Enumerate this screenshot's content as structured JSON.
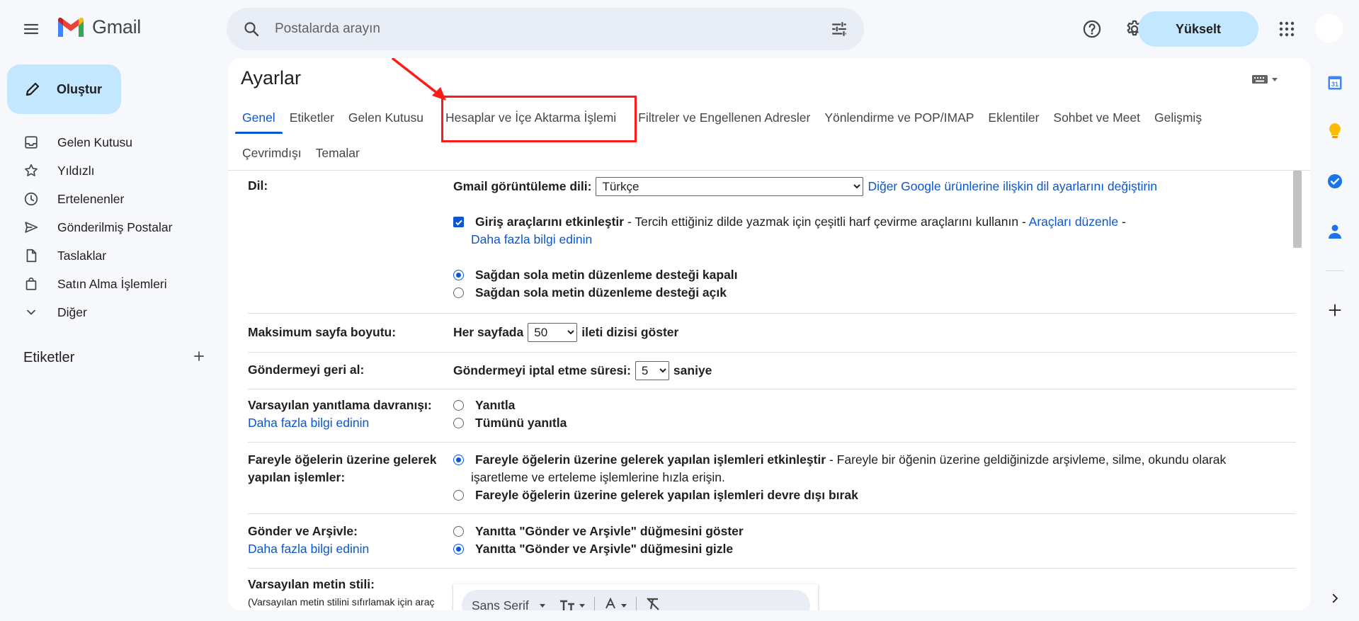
{
  "app": {
    "name": "Gmail"
  },
  "search": {
    "placeholder": "Postalarda arayın"
  },
  "header": {
    "upgrade_label": "Yükselt"
  },
  "compose": {
    "label": "Oluştur"
  },
  "nav": {
    "items": [
      {
        "label": "Gelen Kutusu",
        "icon": "inbox-icon"
      },
      {
        "label": "Yıldızlı",
        "icon": "star-icon"
      },
      {
        "label": "Ertelenenler",
        "icon": "clock-icon"
      },
      {
        "label": "Gönderilmiş Postalar",
        "icon": "send-icon"
      },
      {
        "label": "Taslaklar",
        "icon": "draft-icon"
      },
      {
        "label": "Satın Alma İşlemleri",
        "icon": "shopping-bag-icon"
      },
      {
        "label": "Diğer",
        "icon": "chevron-down-icon"
      }
    ],
    "labels_heading": "Etiketler"
  },
  "settings": {
    "title": "Ayarlar",
    "tabs": [
      "Genel",
      "Etiketler",
      "Gelen Kutusu",
      "Hesaplar ve İçe Aktarma İşlemi",
      "Filtreler ve Engellenen Adresler",
      "Yönlendirme ve POP/IMAP",
      "Eklentiler",
      "Sohbet ve Meet",
      "Gelişmiş",
      "Çevrimdışı",
      "Temalar"
    ],
    "active_tab": "Genel",
    "highlighted_tab": "Hesaplar ve İçe Aktarma İşlemi",
    "language": {
      "label": "Dil:",
      "display_label": "Gmail görüntüleme dili:",
      "display_value": "Türkçe",
      "other_link": "Diğer Google ürünlerine ilişkin dil ayarlarını değiştirin",
      "input_tools_label": "Giriş araçlarını etkinleştir",
      "input_tools_desc": " - Tercih ettiğiniz dilde yazmak için çeşitli harf çevirme araçlarını kullanın - ",
      "edit_tools_link": "Araçları düzenle",
      "dash": " -",
      "learn_more": "Daha fazla bilgi edinin",
      "rtl_off": "Sağdan sola metin düzenleme desteği kapalı",
      "rtl_on": "Sağdan sola metin düzenleme desteği açık"
    },
    "page_size": {
      "label": "Maksimum sayfa boyutu:",
      "prefix": "Her sayfada",
      "value": "50",
      "suffix": "ileti dizisi göster"
    },
    "undo_send": {
      "label": "Göndermeyi geri al:",
      "prefix": "Göndermeyi iptal etme süresi:",
      "value": "5",
      "suffix": "saniye"
    },
    "reply": {
      "label": "Varsayılan yanıtlama davranışı:",
      "learn_more": "Daha fazla bilgi edinin",
      "opt1": "Yanıtla",
      "opt2": "Tümünü yanıtla"
    },
    "hover": {
      "label": "Fareyle öğelerin üzerine gelerek yapılan işlemler:",
      "opt1": "Fareyle öğelerin üzerine gelerek yapılan işlemleri etkinleştir",
      "opt1_desc": " - Fareyle bir öğenin üzerine geldiğinizde arşivleme, silme, okundu olarak",
      "opt1_desc2": "işaretleme ve erteleme işlemlerine hızla erişin.",
      "opt2": "Fareyle öğelerin üzerine gelerek yapılan işlemleri devre dışı bırak"
    },
    "send_archive": {
      "label": "Gönder ve Arşivle:",
      "learn_more": "Daha fazla bilgi edinin",
      "opt1": "Yanıtta \"Gönder ve Arşivle\" düğmesini göster",
      "opt2": "Yanıtta \"Gönder ve Arşivle\" düğmesini gizle"
    },
    "text_style": {
      "label": "Varsayılan metin stili:",
      "note": "(Varsayılan metin stilini sıfırlamak için araç",
      "font": "Sans Serif"
    }
  },
  "colors": {
    "accent": "#0b57d0",
    "compose_bg": "#c2e7ff",
    "highlight": "#ff1a1a"
  }
}
